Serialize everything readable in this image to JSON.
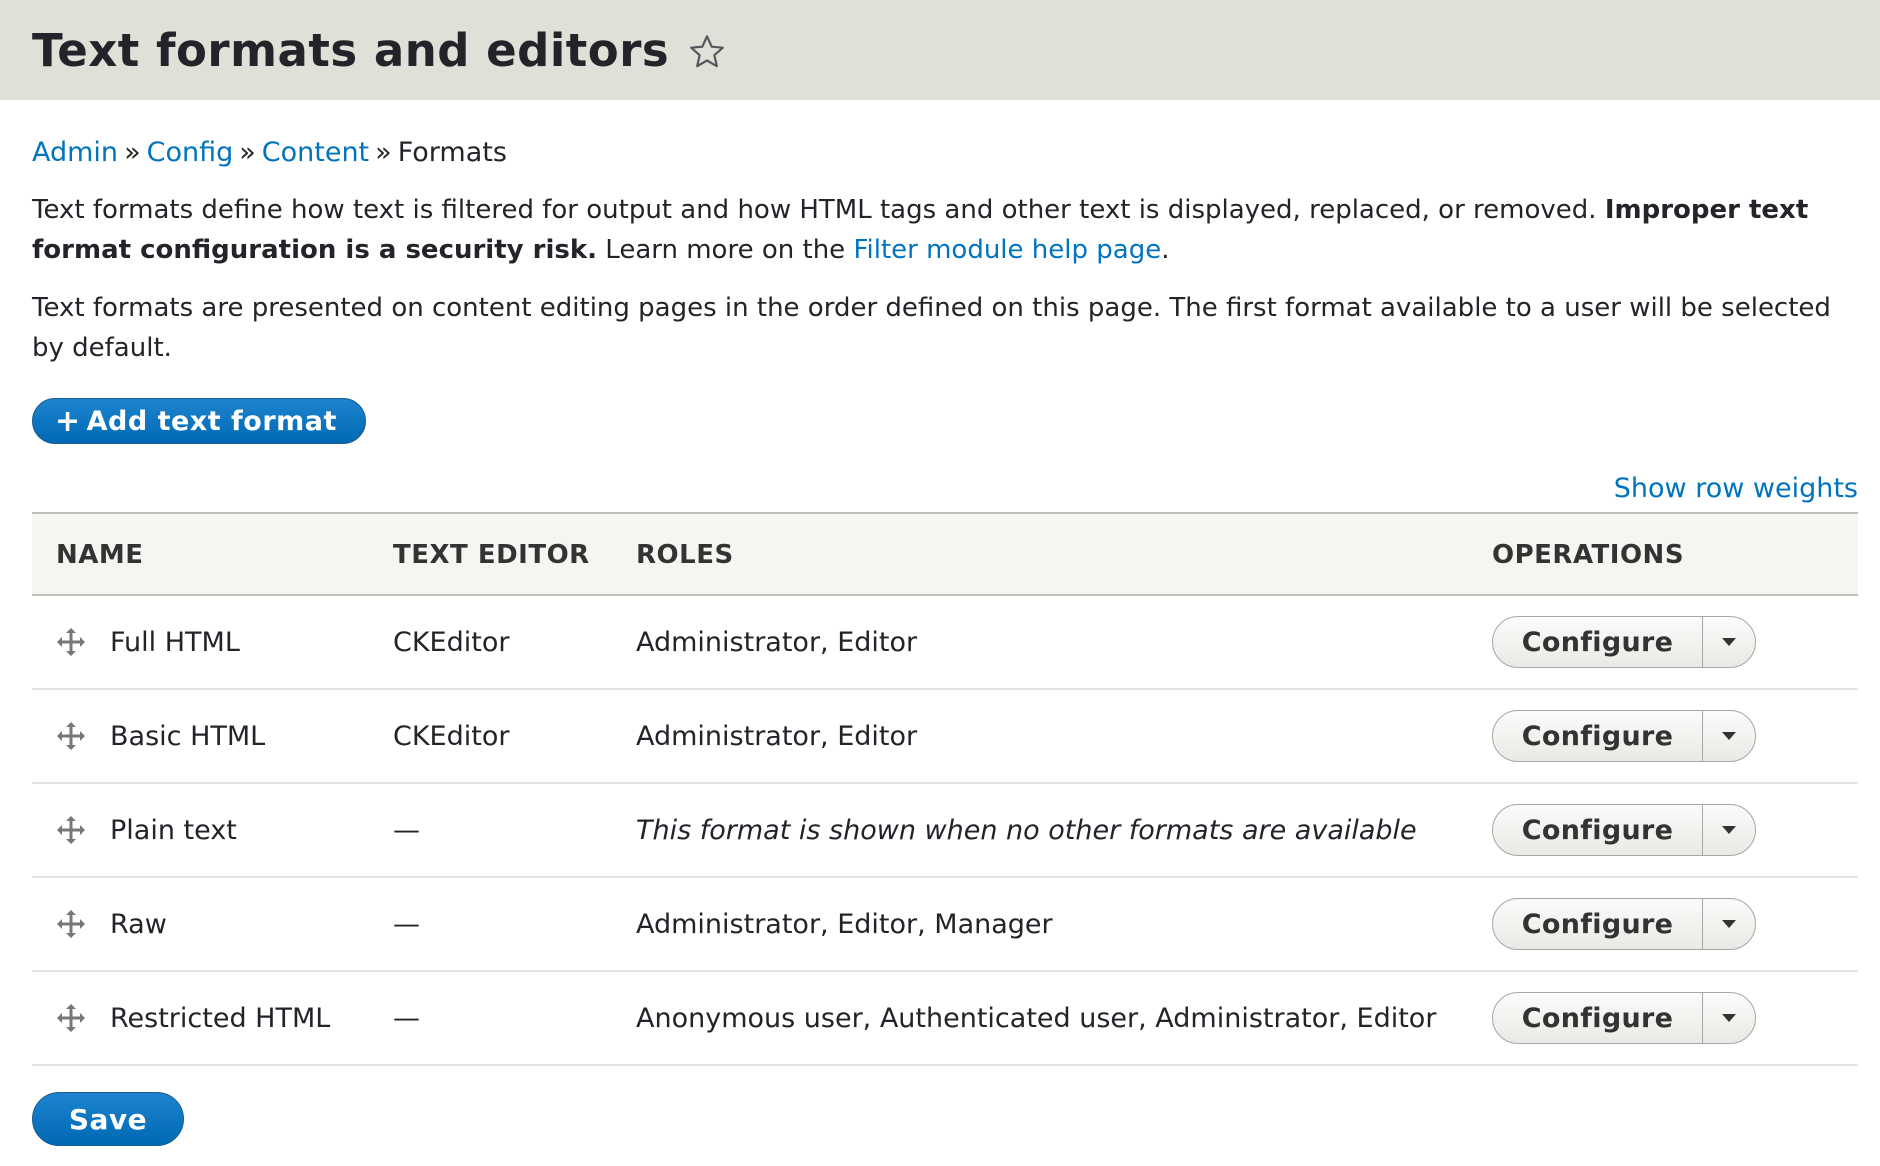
{
  "header": {
    "title": "Text formats and editors",
    "star_icon": "star-outline-icon"
  },
  "breadcrumb": {
    "items": [
      "Admin",
      "Config",
      "Content"
    ],
    "separator": "»",
    "current": "Formats"
  },
  "description": {
    "p1_text": "Text formats define how text is filtered for output and how HTML tags and other text is displayed, replaced, or removed.",
    "p1_warning": "Improper text format configuration is a security risk.",
    "p1_learn": "Learn more on the",
    "p1_link": "Filter module help page",
    "p1_end": ".",
    "p2": "Text formats are presented on content editing pages in the order defined on this page. The first format available to a user will be selected by default."
  },
  "actions": {
    "add_icon": "+",
    "add_label": "Add text format",
    "show_weights": "Show row weights",
    "save_label": "Save"
  },
  "table": {
    "headers": {
      "name": "NAME",
      "editor": "TEXT EDITOR",
      "roles": "ROLES",
      "operations": "OPERATIONS"
    },
    "rows": [
      {
        "name": "Full HTML",
        "editor": "CKEditor",
        "roles": "Administrator, Editor",
        "op": "Configure"
      },
      {
        "name": "Basic HTML",
        "editor": "CKEditor",
        "roles": "Administrator, Editor",
        "op": "Configure"
      },
      {
        "name": "Plain text",
        "editor": "—",
        "roles": "This format is shown when no other formats are available",
        "op": "Configure"
      },
      {
        "name": "Raw",
        "editor": "—",
        "roles": "Administrator, Editor, Manager",
        "op": "Configure"
      },
      {
        "name": "Restricted HTML",
        "editor": "—",
        "roles": "Anonymous user, Authenticated user, Administrator, Editor",
        "op": "Configure"
      }
    ]
  },
  "colors": {
    "header_bg": "#e0e0d8",
    "link": "#0074bd",
    "primary_button": "#0071b8",
    "table_header_bg": "#f5f5f2"
  }
}
